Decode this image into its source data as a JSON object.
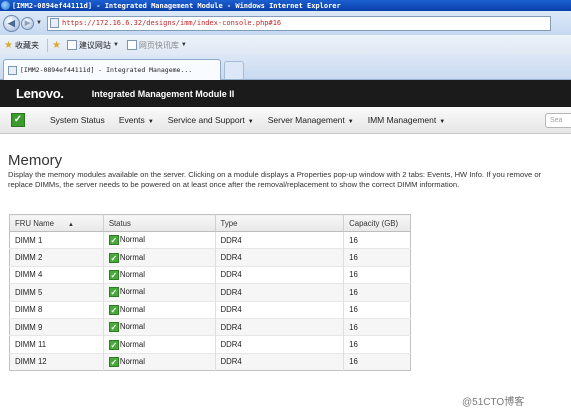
{
  "browser": {
    "title": "[IMM2-0894ef44111d] - Integrated Management Module - Windows Internet Explorer",
    "url": "https://172.16.6.32/designs/imm/index-console.php#16",
    "favorites": {
      "label": "收藏夹",
      "suggested_sites": "建议网站",
      "web_slice": "网页快讯库"
    },
    "tab_title": "[IMM2-0894ef44111d] - Integrated Manageme..."
  },
  "app": {
    "brand": "Lenovo.",
    "title": "Integrated Management Module II"
  },
  "nav": {
    "items": [
      "System Status",
      "Events",
      "Service and Support",
      "Server Management",
      "IMM Management"
    ],
    "search_placeholder": "Sea"
  },
  "page": {
    "title": "Memory",
    "description": "Display the memory modules available on the server. Clicking on a module displays a Properties pop-up window with 2 tabs: Events, HW Info. If you remove or replace DIMMs, the server needs to be powered on at least once after the removal/replacement to show the correct DIMM information."
  },
  "table": {
    "headers": [
      "FRU Name",
      "Status",
      "Type",
      "Capacity (GB)"
    ],
    "rows": [
      [
        "DIMM 1",
        "Normal",
        "DDR4",
        "16"
      ],
      [
        "DIMM 2",
        "Normal",
        "DDR4",
        "16"
      ],
      [
        "DIMM 4",
        "Normal",
        "DDR4",
        "16"
      ],
      [
        "DIMM 5",
        "Normal",
        "DDR4",
        "16"
      ],
      [
        "DIMM 8",
        "Normal",
        "DDR4",
        "16"
      ],
      [
        "DIMM 9",
        "Normal",
        "DDR4",
        "16"
      ],
      [
        "DIMM 11",
        "Normal",
        "DDR4",
        "16"
      ],
      [
        "DIMM 12",
        "Normal",
        "DDR4",
        "16"
      ]
    ]
  },
  "watermark": "@51CTO博客",
  "colors": {
    "header_bg": "#1b1b1b",
    "link": "#1a57b5",
    "status_ok": "#48a83a",
    "url_text": "#c0272d"
  }
}
